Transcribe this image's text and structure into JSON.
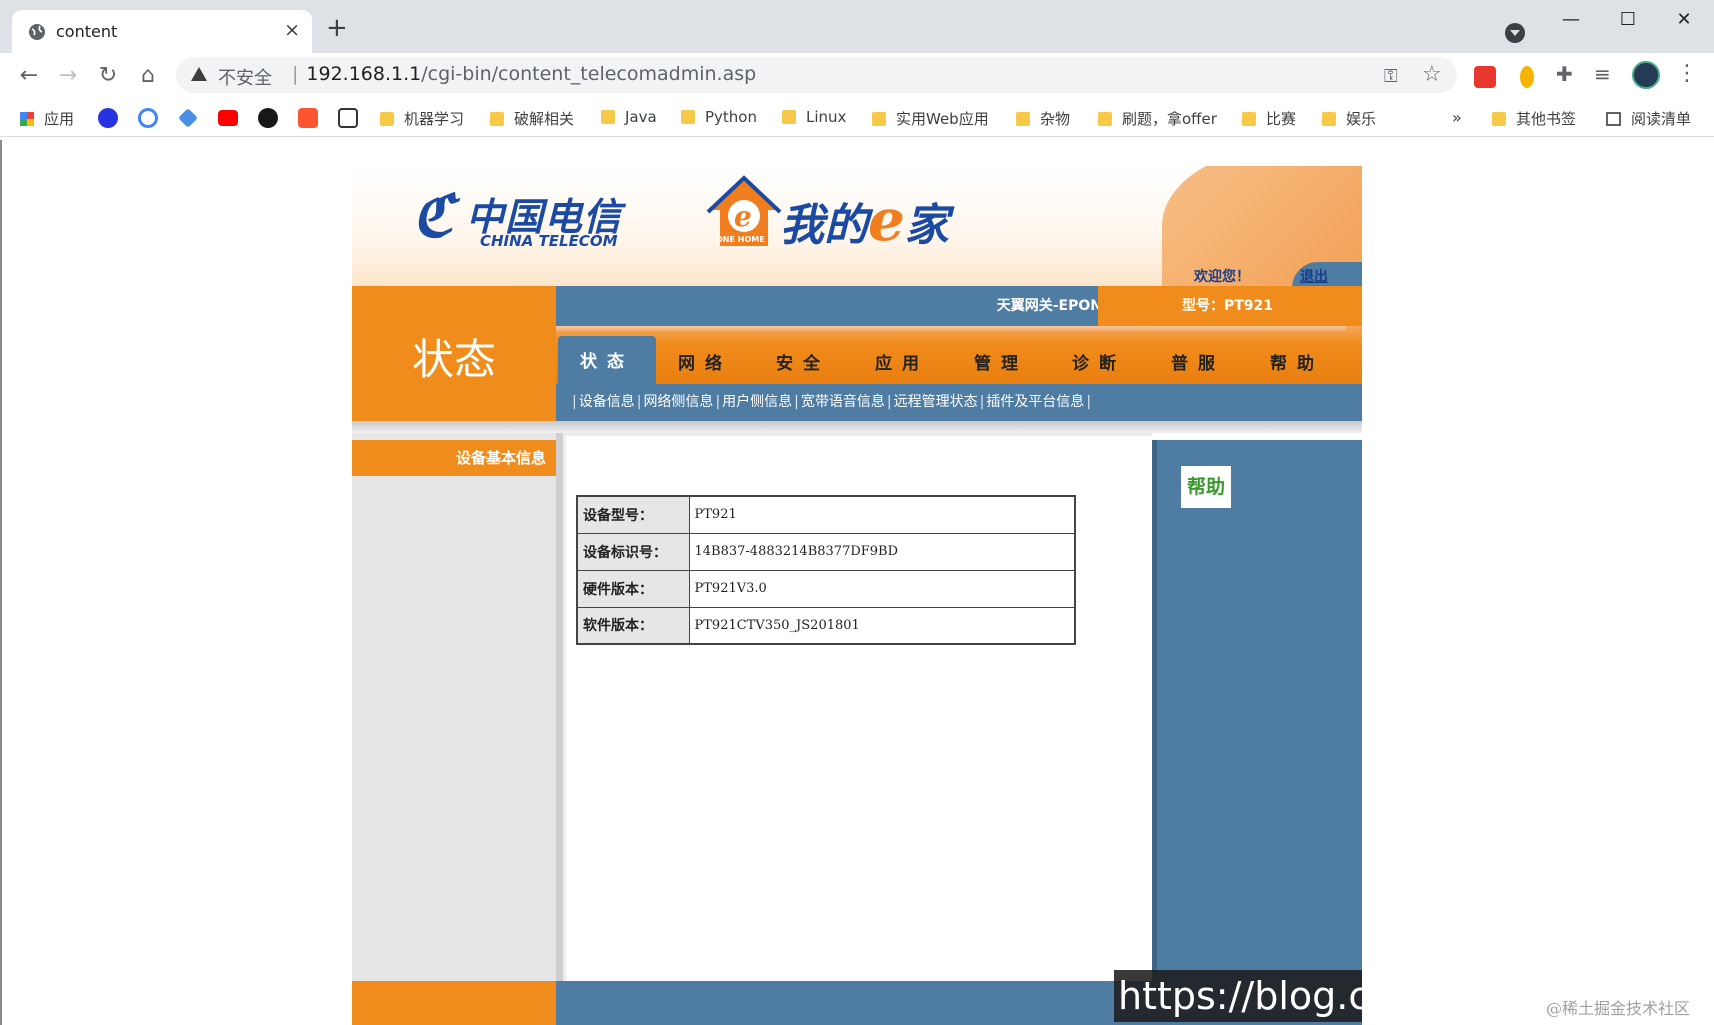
{
  "browser": {
    "tab_title": "content",
    "tab_close": "×",
    "new_tab": "+",
    "window_controls": {
      "minimize": "—",
      "maximize": "☐",
      "close": "✕"
    },
    "address": {
      "insecure_label": "不安全",
      "separator": "|",
      "host": "192.168.1.1",
      "path": "/cgi-bin/content_telecomadmin.asp"
    },
    "bookmarks": [
      {
        "label": "应用",
        "icon": "apps-grid-icon"
      },
      {
        "label": "",
        "icon": "baidu-icon"
      },
      {
        "label": "",
        "icon": "google-icon"
      },
      {
        "label": "",
        "icon": "graduation-icon"
      },
      {
        "label": "",
        "icon": "youtube-icon"
      },
      {
        "label": "",
        "icon": "github-icon"
      },
      {
        "label": "",
        "icon": "csdn-icon"
      },
      {
        "label": "",
        "icon": "zhihu-icon"
      },
      {
        "label": "机器学习",
        "icon": "folder-icon"
      },
      {
        "label": "破解相关",
        "icon": "folder-icon"
      },
      {
        "label": "Java",
        "icon": "folder-icon"
      },
      {
        "label": "Python",
        "icon": "folder-icon"
      },
      {
        "label": "Linux",
        "icon": "folder-icon"
      },
      {
        "label": "实用Web应用",
        "icon": "folder-icon"
      },
      {
        "label": "杂物",
        "icon": "folder-icon"
      },
      {
        "label": "刷题，拿offer",
        "icon": "folder-icon"
      },
      {
        "label": "比赛",
        "icon": "folder-icon"
      },
      {
        "label": "娱乐",
        "icon": "folder-icon"
      }
    ],
    "bookmarks_overflow": "»",
    "other_bookmarks": "其他书签",
    "reading_list": "阅读清单"
  },
  "router": {
    "brand_cn": "中国电信",
    "brand_en": "CHINA TELECOM",
    "ehome_prefix": "我的",
    "ehome_e": "e",
    "ehome_suffix": "家",
    "ehome_badge": "ONE HOME",
    "welcome": "欢迎您！",
    "logout": "退出",
    "section_title": "状态",
    "gateway_name": "天翼网关-EPON",
    "model_label": "型号：PT921",
    "menu": [
      "状态",
      "网络",
      "安全",
      "应用",
      "管理",
      "诊断",
      "普服",
      "帮助"
    ],
    "active_menu": "状态",
    "submenu": [
      "设备信息",
      "网络侧信息",
      "用户侧信息",
      "宽带语音信息",
      "远程管理状态",
      "插件及平台信息"
    ],
    "left_active_item": "设备基本信息",
    "help_button": "帮助",
    "device_info": [
      {
        "label": "设备型号：",
        "value": "PT921"
      },
      {
        "label": "设备标识号：",
        "value": "14B837-4883214B8377DF9BD"
      },
      {
        "label": "硬件版本：",
        "value": "PT921V3.0"
      },
      {
        "label": "软件版本：",
        "value": "PT921CTV350_JS201801"
      }
    ]
  },
  "overlay": {
    "watermark_url": "https://blog.cs",
    "credit": "@稀土掘金技术社区"
  }
}
